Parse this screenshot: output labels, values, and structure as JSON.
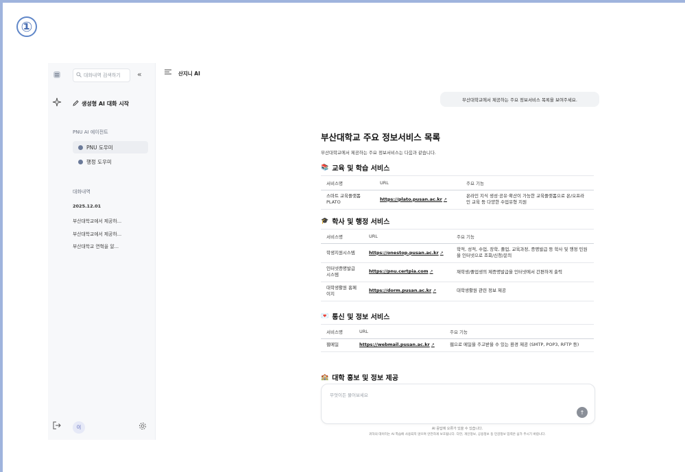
{
  "step_marker": "①",
  "rail": {
    "logo_icon": "app-logo-icon",
    "spark_icon": "sparkle-icon",
    "logout_icon": "logout-icon"
  },
  "sidebar": {
    "search_placeholder": "대화내역 검색하기",
    "collapse_glyph": "«",
    "new_chat_label": "생성형 AI 대화 시작",
    "agents_section_label": "PNU AI 에이전트",
    "agents": [
      {
        "label": "PNU 도우미"
      },
      {
        "label": "행정 도우미"
      }
    ],
    "history_section_label": "대화내역",
    "history_date": "2025.12.01",
    "history_items": [
      "부산대학교에서 제공하...",
      "부산대학교에서 제공하...",
      "부산대학교 연혁을 알..."
    ],
    "avatar_initial": "이"
  },
  "topbar": {
    "title": "산지니 AI"
  },
  "chat": {
    "user_message": "부산대학교에서 제공하는 주요 정보서비스 목록을 보여주세요.",
    "heading": "부산대학교 주요 정보서비스 목록",
    "intro": "부산대학교에서 제공하는 주요 정보서비스는 다음과 같습니다.",
    "columns": [
      "서비스명",
      "URL",
      "주요 기능"
    ],
    "sections": [
      {
        "title": "교육 및 학습 서비스",
        "emoji": "📚",
        "rows": [
          [
            "스마트 교육플랫폼 PLATO",
            "https://plato.pusan.ac.kr",
            "온라인 지식 생성·공유·확산이 가능한 교육플랫폼으로 온/오프라인 교육 등 다양한 수업유형 지원"
          ]
        ]
      },
      {
        "title": "학사 및 행정 서비스",
        "emoji": "🎓",
        "rows": [
          [
            "학생지원시스템",
            "https://onestop.pusan.ac.kr",
            "학적, 성적, 수업, 장학, 졸업, 교육과정, 증명발급 등 학사 및 행정 민원을 인터넷으로 조회/신청/문의"
          ],
          [
            "인터넷증명발급시스템",
            "https://pnu.certpia.com",
            "재학생/졸업생의 제증명발급을 인터넷에서 간편하게 출력"
          ],
          [
            "대학생활원 홈페이지",
            "https://dorm.pusan.ac.kr",
            "대학생활원 관련 정보 제공"
          ]
        ]
      },
      {
        "title": "통신 및 정보 서비스",
        "emoji": "💌",
        "rows": [
          [
            "웹메일",
            "https://webmail.pusan.ac.kr",
            "웹으로 메일을 주고받을 수 있는 환경 제공 (SMTP, POP3, RFTP 등)"
          ]
        ]
      },
      {
        "title": "대학 홍보 및 정보 제공",
        "emoji": "🏫",
        "rows": []
      }
    ],
    "input_placeholder": "무엇이든 물어보세요",
    "notice_line1": "AI 응답에 오류가 있을 수 있습니다.",
    "notice_line2": "귀하의 데이터는 AI 학습에 사용되지 않으며 안전하게 보호됩니다. 다만, 개인정보, 공용정보 등 민감정보 입력은 삼가 주시기 바랍니다."
  }
}
